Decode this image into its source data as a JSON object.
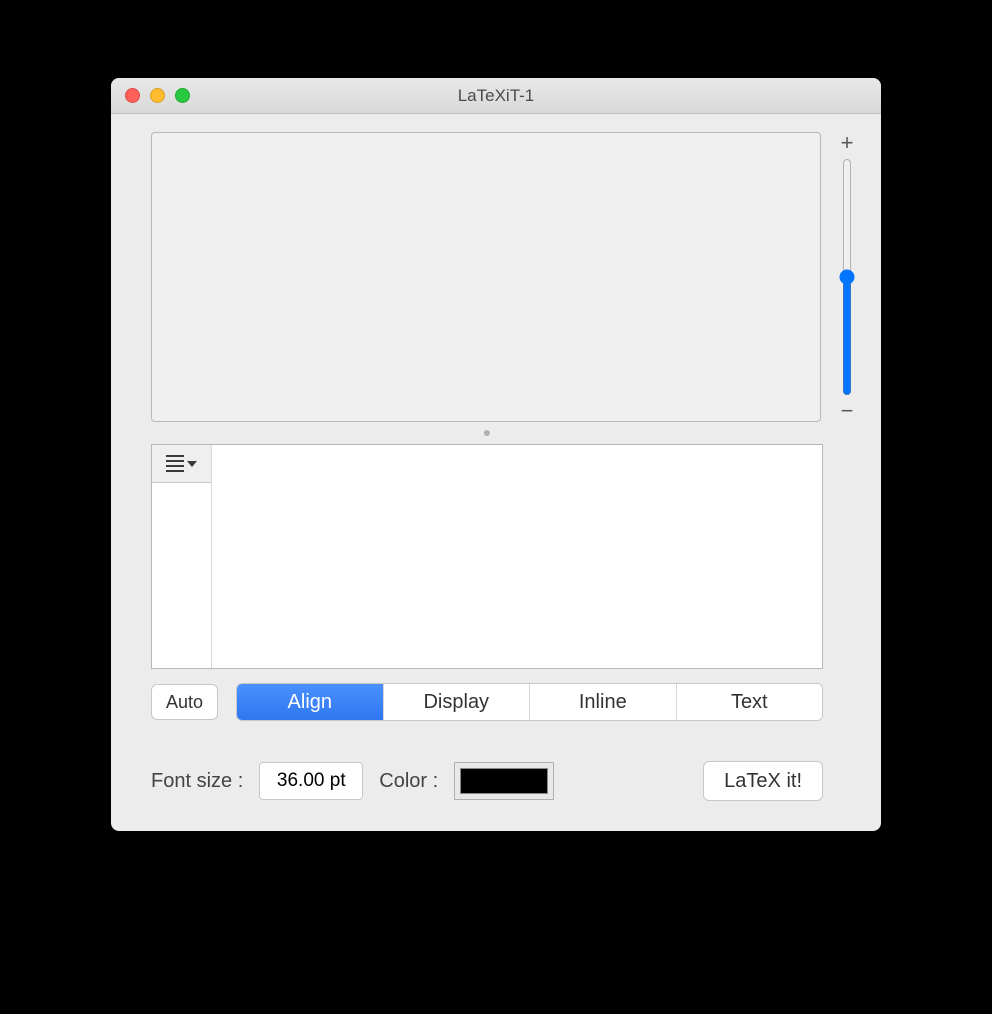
{
  "window": {
    "title": "LaTeXiT-1"
  },
  "zoom": {
    "plus": "+",
    "minus": "−"
  },
  "modes": {
    "auto": "Auto",
    "tabs": [
      "Align",
      "Display",
      "Inline",
      "Text"
    ],
    "active_index": 0
  },
  "font": {
    "label": "Font size :",
    "value": "36.00 pt"
  },
  "color": {
    "label": "Color :",
    "value": "#000000"
  },
  "action": {
    "latex_it": "LaTeX it!"
  }
}
